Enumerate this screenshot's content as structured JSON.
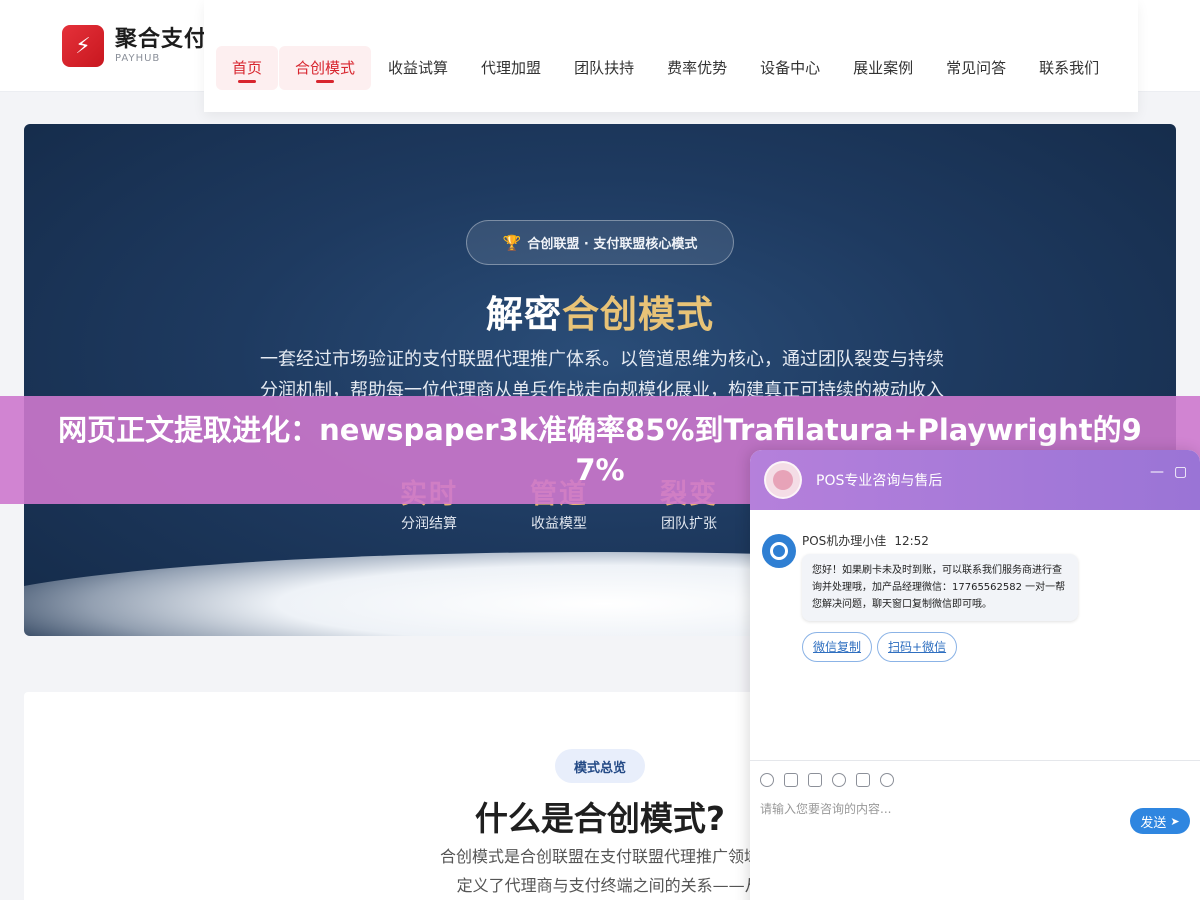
{
  "header": {
    "logo_mark": "⚡",
    "logo_name": "聚合支付",
    "logo_sub": "PAYHUB",
    "nav": [
      "首页",
      "合创模式",
      "收益试算",
      "代理加盟",
      "团队扶持",
      "费率优势",
      "设备中心",
      "展业案例",
      "常见问答",
      "联系我们"
    ]
  },
  "hero": {
    "badge": "合创联盟 · 支付联盟核心模式",
    "title_main": "解密",
    "title_accent": "合创模式",
    "desc": "一套经过市场验证的支付联盟代理推广体系。以管道思维为核心，通过团队裂变与持续分润机制，帮助每一位代理商从单兵作战走向规模化展业，构建真正可持续的被动收入",
    "stats": [
      {
        "value": "实时",
        "label": "分润结算"
      },
      {
        "value": "管道",
        "label": "收益模型"
      },
      {
        "value": "裂变",
        "label": "团队扩张"
      }
    ]
  },
  "section": {
    "pill": "模式总览",
    "title": "什么是合创模式?",
    "desc_line1": "合创模式是合创联盟在支付联盟代理推广领域独创的一套完整",
    "desc_line2": "定义了代理商与支付终端之间的关系——从\"卖设备\"转变"
  },
  "banner": {
    "text": "网页正文提取进化：newspaper3k准确率85%到Trafilatura+Playwright的97%"
  },
  "chat": {
    "title": "POS专业咨询与售后",
    "agent_name": "POS机办理小佳",
    "time": "12:52",
    "message": "您好！如果刷卡未及时到账，可以联系我们服务商进行查询并处理哦，加产品经理微信：17765562582 一对一帮您解决问题，聊天窗口复制微信即可哦。",
    "quick_replies": [
      "微信复制",
      "扫码+微信"
    ],
    "input_placeholder": "请输入您要咨询的内容...",
    "send_label": "发送"
  }
}
